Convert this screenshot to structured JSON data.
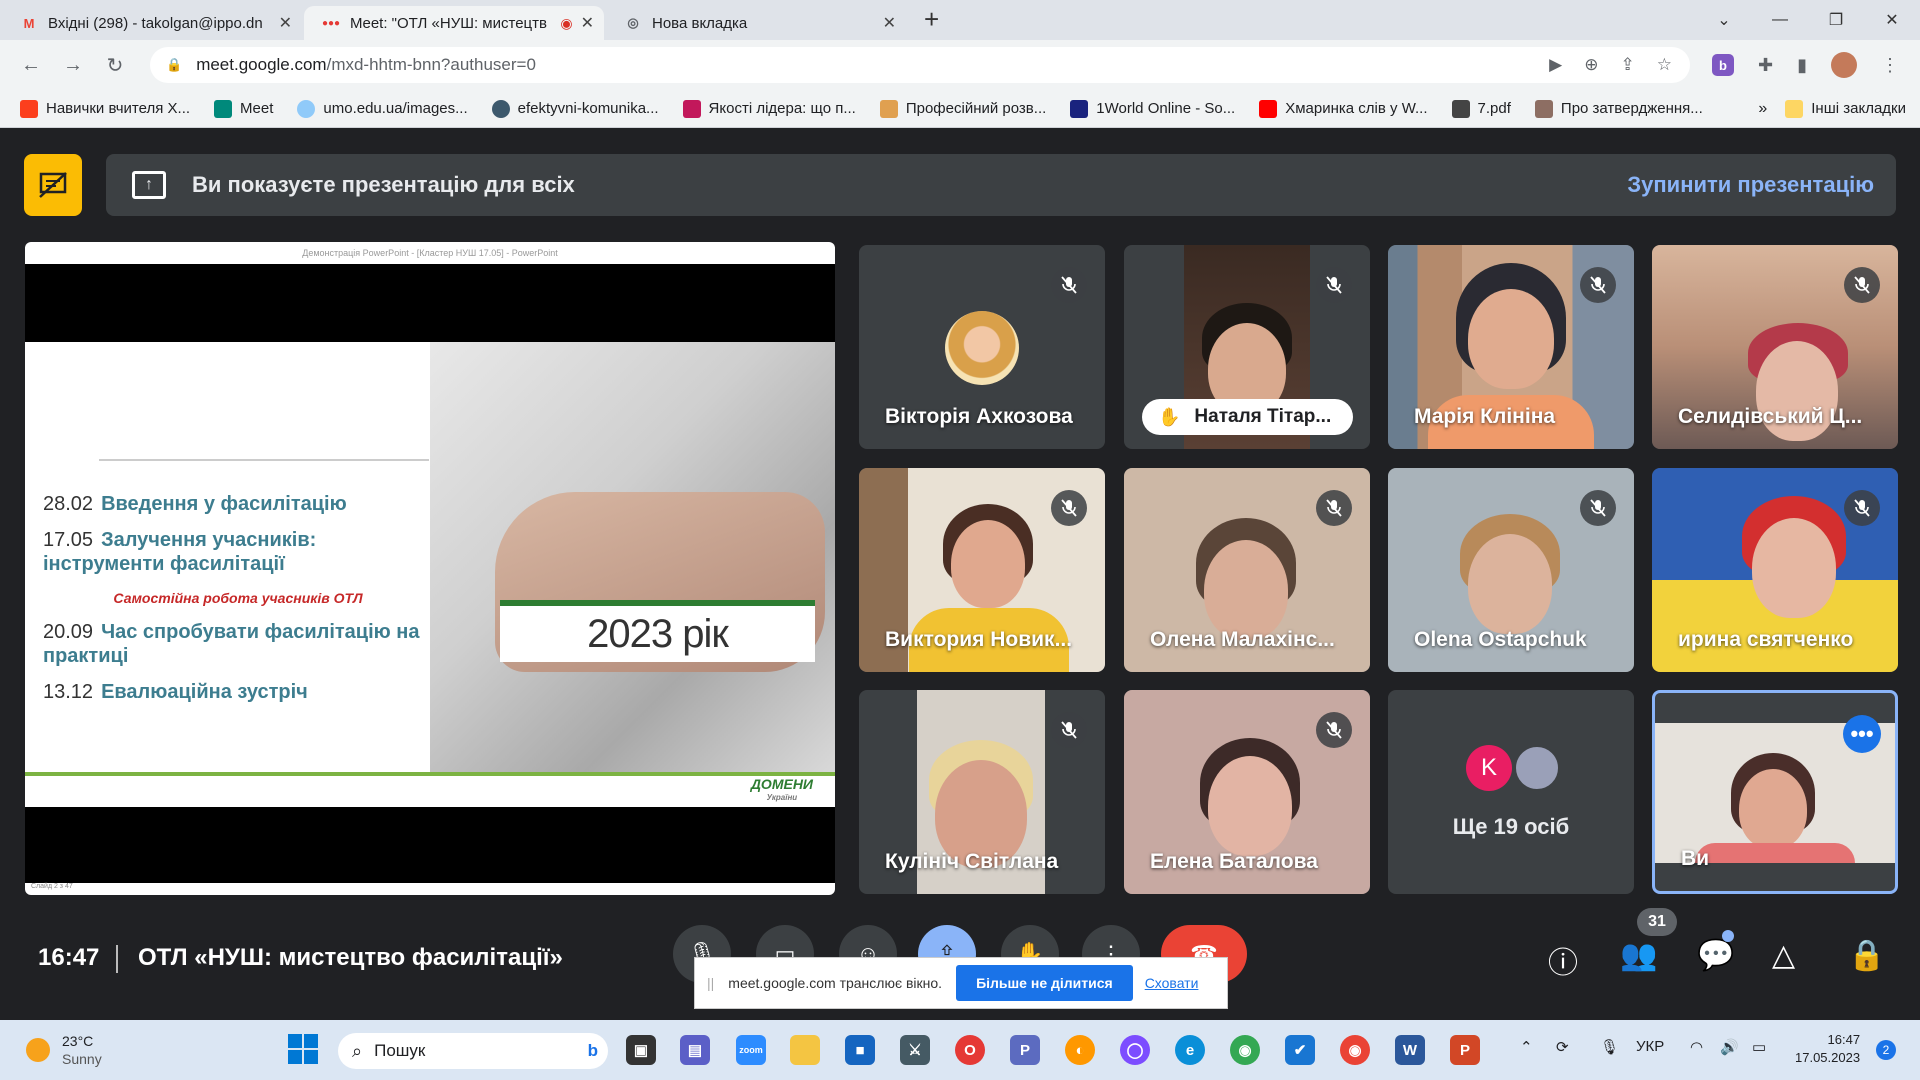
{
  "browser": {
    "tabs": [
      {
        "title": "Вхідні (298) - takolgan@ippo.dn",
        "icon": "gmail-icon"
      },
      {
        "title": "Meet: \"ОТЛ «НУШ: мистецтв",
        "icon": "meet-icon"
      },
      {
        "title": "Нова вкладка",
        "icon": "chrome-icon"
      }
    ],
    "url_host": "meet.google.com",
    "url_path": "/mxd-hhtm-bnn?authuser=0",
    "bookmarks": [
      "Навички вчителя Х...",
      "Meet",
      "umo.edu.ua/images...",
      "efektyvni-komunika...",
      "Якості лідера: що п...",
      "Професійний розв...",
      "1World Online - So...",
      "Хмаринка слів у W...",
      "7.pdf",
      "Про затвердження..."
    ],
    "bookmarks_more": "»",
    "other_bookmarks": "Інші закладки"
  },
  "meet": {
    "banner_text": "Ви показуєте презентацію для всіх",
    "stop_presenting": "Зупинити презентацію",
    "time": "16:47",
    "meeting_title": "ОТЛ «НУШ: мистецтво фасилітації»",
    "participant_count": "31",
    "participants": [
      {
        "name": "Вікторія Ахкозова"
      },
      {
        "name": "Наталя Тітар..."
      },
      {
        "name": "Марія Клініна"
      },
      {
        "name": "Селидівський Ц..."
      },
      {
        "name": "Виктория Новик..."
      },
      {
        "name": "Олена Малахінс..."
      },
      {
        "name": "Olena Ostapchuk"
      },
      {
        "name": "ирина святченко"
      },
      {
        "name": "Кулініч Світлана"
      },
      {
        "name": "Елена Баталова"
      }
    ],
    "more_people": "Ще 19 осіб",
    "more_avatar_letter": "K",
    "self_label": "Ви",
    "share_popup": {
      "text": "meet.google.com транслює вікно.",
      "stop": "Більше не ділитися",
      "hide": "Сховати"
    }
  },
  "slide": {
    "window_title": "Демонстрація PowerPoint - [Кластер НУШ 17.05] - PowerPoint",
    "year": "2023 рік",
    "agenda": [
      {
        "date": "28.02",
        "title": "Введення у фасилітацію"
      },
      {
        "date": "17.05",
        "title": "Залучення учасників: інструменти фасилітації"
      },
      {
        "date": "20.09",
        "title": "Час спробувати фасилітацію на практиці"
      },
      {
        "date": "13.12",
        "title": "Евалюаційна зустріч"
      }
    ],
    "note": "Самостійна робота учасників ОТЛ",
    "logo": "ДОМЕНИ",
    "logo_sub": "України",
    "status": "Слайд 2 з 47"
  },
  "taskbar": {
    "temp": "23°C",
    "weather": "Sunny",
    "search": "Пошук",
    "lang": "УКР",
    "time": "16:47",
    "date": "17.05.2023",
    "notifications": "2"
  }
}
